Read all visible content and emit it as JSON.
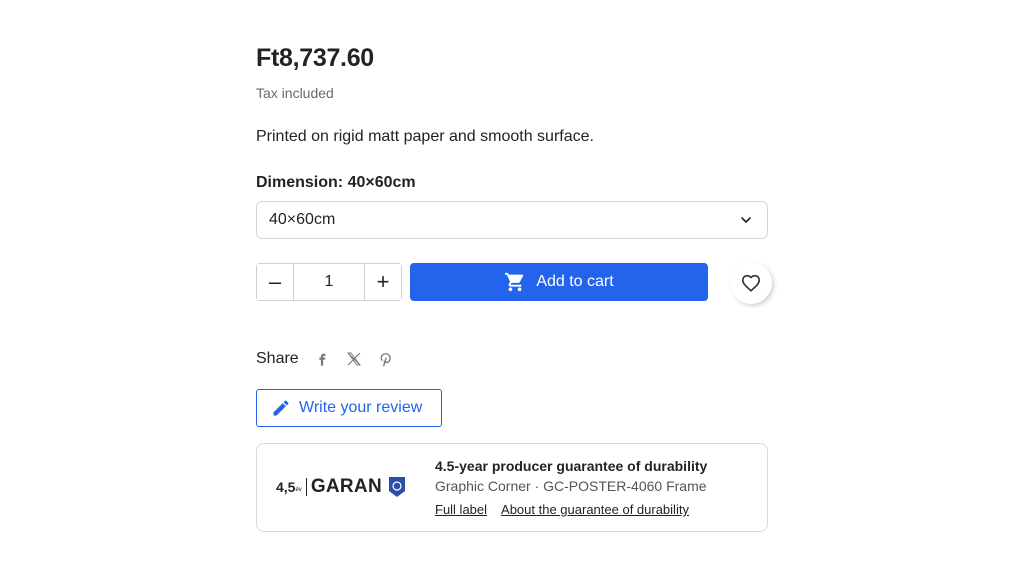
{
  "product": {
    "price": "Ft8,737.60",
    "tax_note": "Tax included",
    "description": "Printed on rigid matt paper and smooth surface."
  },
  "dimension": {
    "label": "Dimension:",
    "current": "40×60cm",
    "selected_option": "40×60cm"
  },
  "quantity": {
    "value": "1",
    "minus_label": "–",
    "plus_label": "+"
  },
  "cart": {
    "label": "Add to cart"
  },
  "share": {
    "label": "Share"
  },
  "review": {
    "label": "Write your review"
  },
  "guarantee": {
    "logo_number": "4,5",
    "logo_word": "GARAN",
    "title": "4.5-year producer guarantee of durability",
    "subtitle": "Graphic Corner · GC-POSTER-4060 Frame",
    "links": [
      "Full label",
      "About the guarantee of durability"
    ]
  },
  "colors": {
    "accent": "#2463eb",
    "text": "#232323",
    "muted": "#6b6b6b"
  }
}
